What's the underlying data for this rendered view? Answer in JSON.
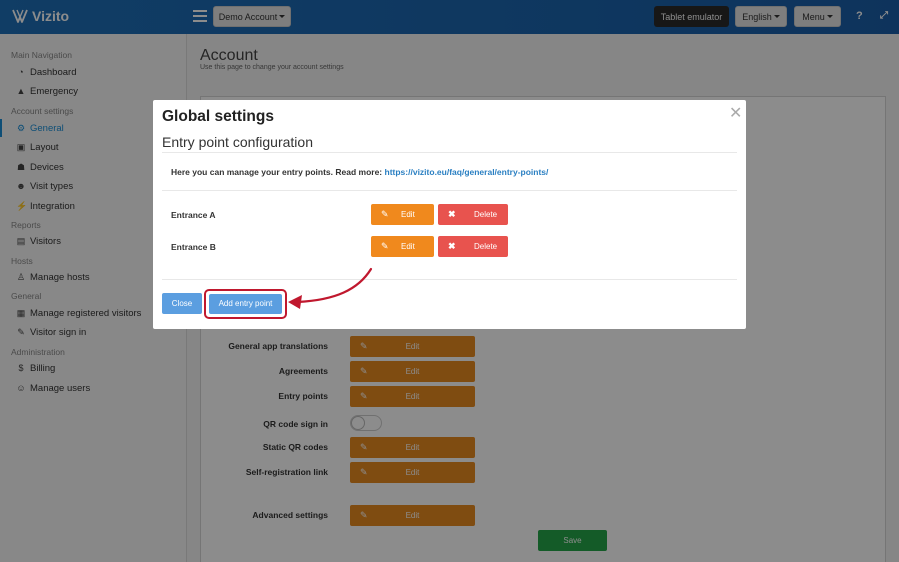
{
  "brand": {
    "name": "Vizito"
  },
  "topbar": {
    "account_select": "Demo Account",
    "tablet_emulator": "Tablet emulator",
    "language": "English",
    "menu": "Menu",
    "help_icon": "question-icon",
    "expand_icon": "expand-icon"
  },
  "sidebar": {
    "sections": [
      {
        "heading": "Main Navigation",
        "items": [
          {
            "label": "Dashboard",
            "icon": "dashboard-icon"
          },
          {
            "label": "Emergency",
            "icon": "warning-icon"
          }
        ]
      },
      {
        "heading": "Account settings",
        "items": [
          {
            "label": "General",
            "icon": "gear-icon",
            "active": true
          },
          {
            "label": "Layout",
            "icon": "image-icon"
          },
          {
            "label": "Devices",
            "icon": "sitemap-icon"
          },
          {
            "label": "Visit types",
            "icon": "users-icon"
          },
          {
            "label": "Integration",
            "icon": "plug-icon"
          }
        ]
      },
      {
        "heading": "Reports",
        "items": [
          {
            "label": "Visitors",
            "icon": "book-icon"
          }
        ]
      },
      {
        "heading": "Hosts",
        "items": [
          {
            "label": "Manage hosts",
            "icon": "male-icon"
          }
        ]
      },
      {
        "heading": "General",
        "items": [
          {
            "label": "Manage registered visitors",
            "icon": "address-book-icon"
          },
          {
            "label": "Visitor sign in",
            "icon": "pencil-icon"
          }
        ]
      },
      {
        "heading": "Administration",
        "items": [
          {
            "label": "Billing",
            "icon": "dollar-icon"
          },
          {
            "label": "Manage users",
            "icon": "user-plus-icon"
          }
        ]
      }
    ]
  },
  "page": {
    "title": "Account",
    "subtitle": "Use this page to change your account settings"
  },
  "form": {
    "edit_label": "Edit",
    "save_label": "Save",
    "rows": [
      {
        "label": "General app translations",
        "type": "edit"
      },
      {
        "label": "Agreements",
        "type": "edit"
      },
      {
        "label": "Entry points",
        "type": "edit"
      },
      {
        "label": "QR code sign in",
        "type": "toggle",
        "on": false
      },
      {
        "label": "Static QR codes",
        "type": "edit"
      },
      {
        "label": "Self-registration link",
        "type": "edit"
      },
      {
        "label": "Advanced settings",
        "type": "edit"
      }
    ]
  },
  "modal": {
    "title": "Global settings",
    "subtitle": "Entry point configuration",
    "info_text": "Here you can manage your entry points. Read more:",
    "info_link": "https://vizito.eu/faq/general/entry-points/",
    "edit_label": "Edit",
    "delete_label": "Delete",
    "entries": [
      {
        "name": "Entrance A"
      },
      {
        "name": "Entrance B"
      }
    ],
    "close_label": "Close",
    "add_label": "Add entry point"
  },
  "colors": {
    "topbar": "#1e6fb8",
    "edit_orange": "#f0891d",
    "delete_red": "#e8534e",
    "primary_blue": "#5b9ee0",
    "save_green": "#25a74a",
    "highlight_red": "#c0182e"
  }
}
